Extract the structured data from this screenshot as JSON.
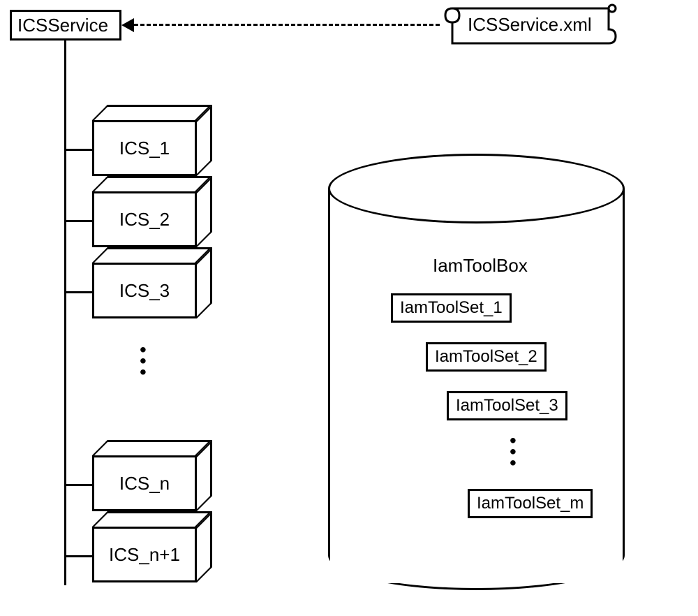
{
  "service": {
    "root_label": "ICSService",
    "xml_label": "ICSService.xml"
  },
  "ics_nodes": [
    {
      "label": "ICS_1"
    },
    {
      "label": "ICS_2"
    },
    {
      "label": "ICS_3"
    },
    {
      "label": "ICS_n"
    },
    {
      "label": "ICS_n+1"
    }
  ],
  "toolbox": {
    "title": "IamToolBox",
    "toolsets": [
      "IamToolSet_1",
      "IamToolSet_2",
      "IamToolSet_3",
      "IamToolSet_m"
    ]
  }
}
